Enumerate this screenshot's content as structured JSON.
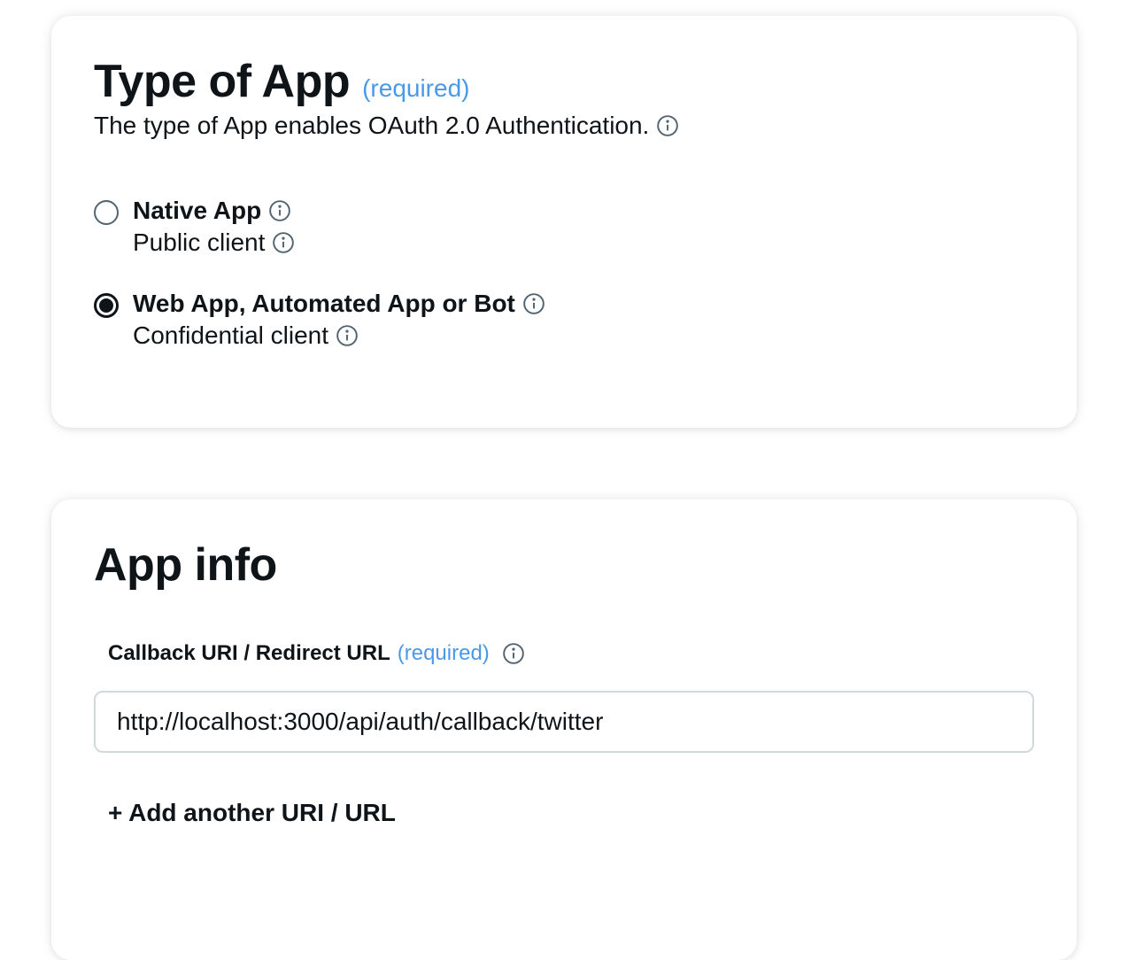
{
  "type_of_app": {
    "title": "Type of App",
    "required": "(required)",
    "description": "The type of App enables OAuth 2.0 Authentication.",
    "options": [
      {
        "label": "Native App",
        "sub": "Public client",
        "checked": false
      },
      {
        "label": "Web App, Automated App or Bot",
        "sub": "Confidential client",
        "checked": true
      }
    ]
  },
  "app_info": {
    "title": "App info",
    "callback_label": "Callback URI / Redirect URL",
    "required": "(required)",
    "callback_value": "http://localhost:3000/api/auth/callback/twitter",
    "add_link": "+ Add another URI / URL"
  },
  "colors": {
    "accent": "#4a99e9",
    "text": "#0f1419",
    "border": "#cfd9de"
  },
  "icons": [
    "info-icon"
  ]
}
